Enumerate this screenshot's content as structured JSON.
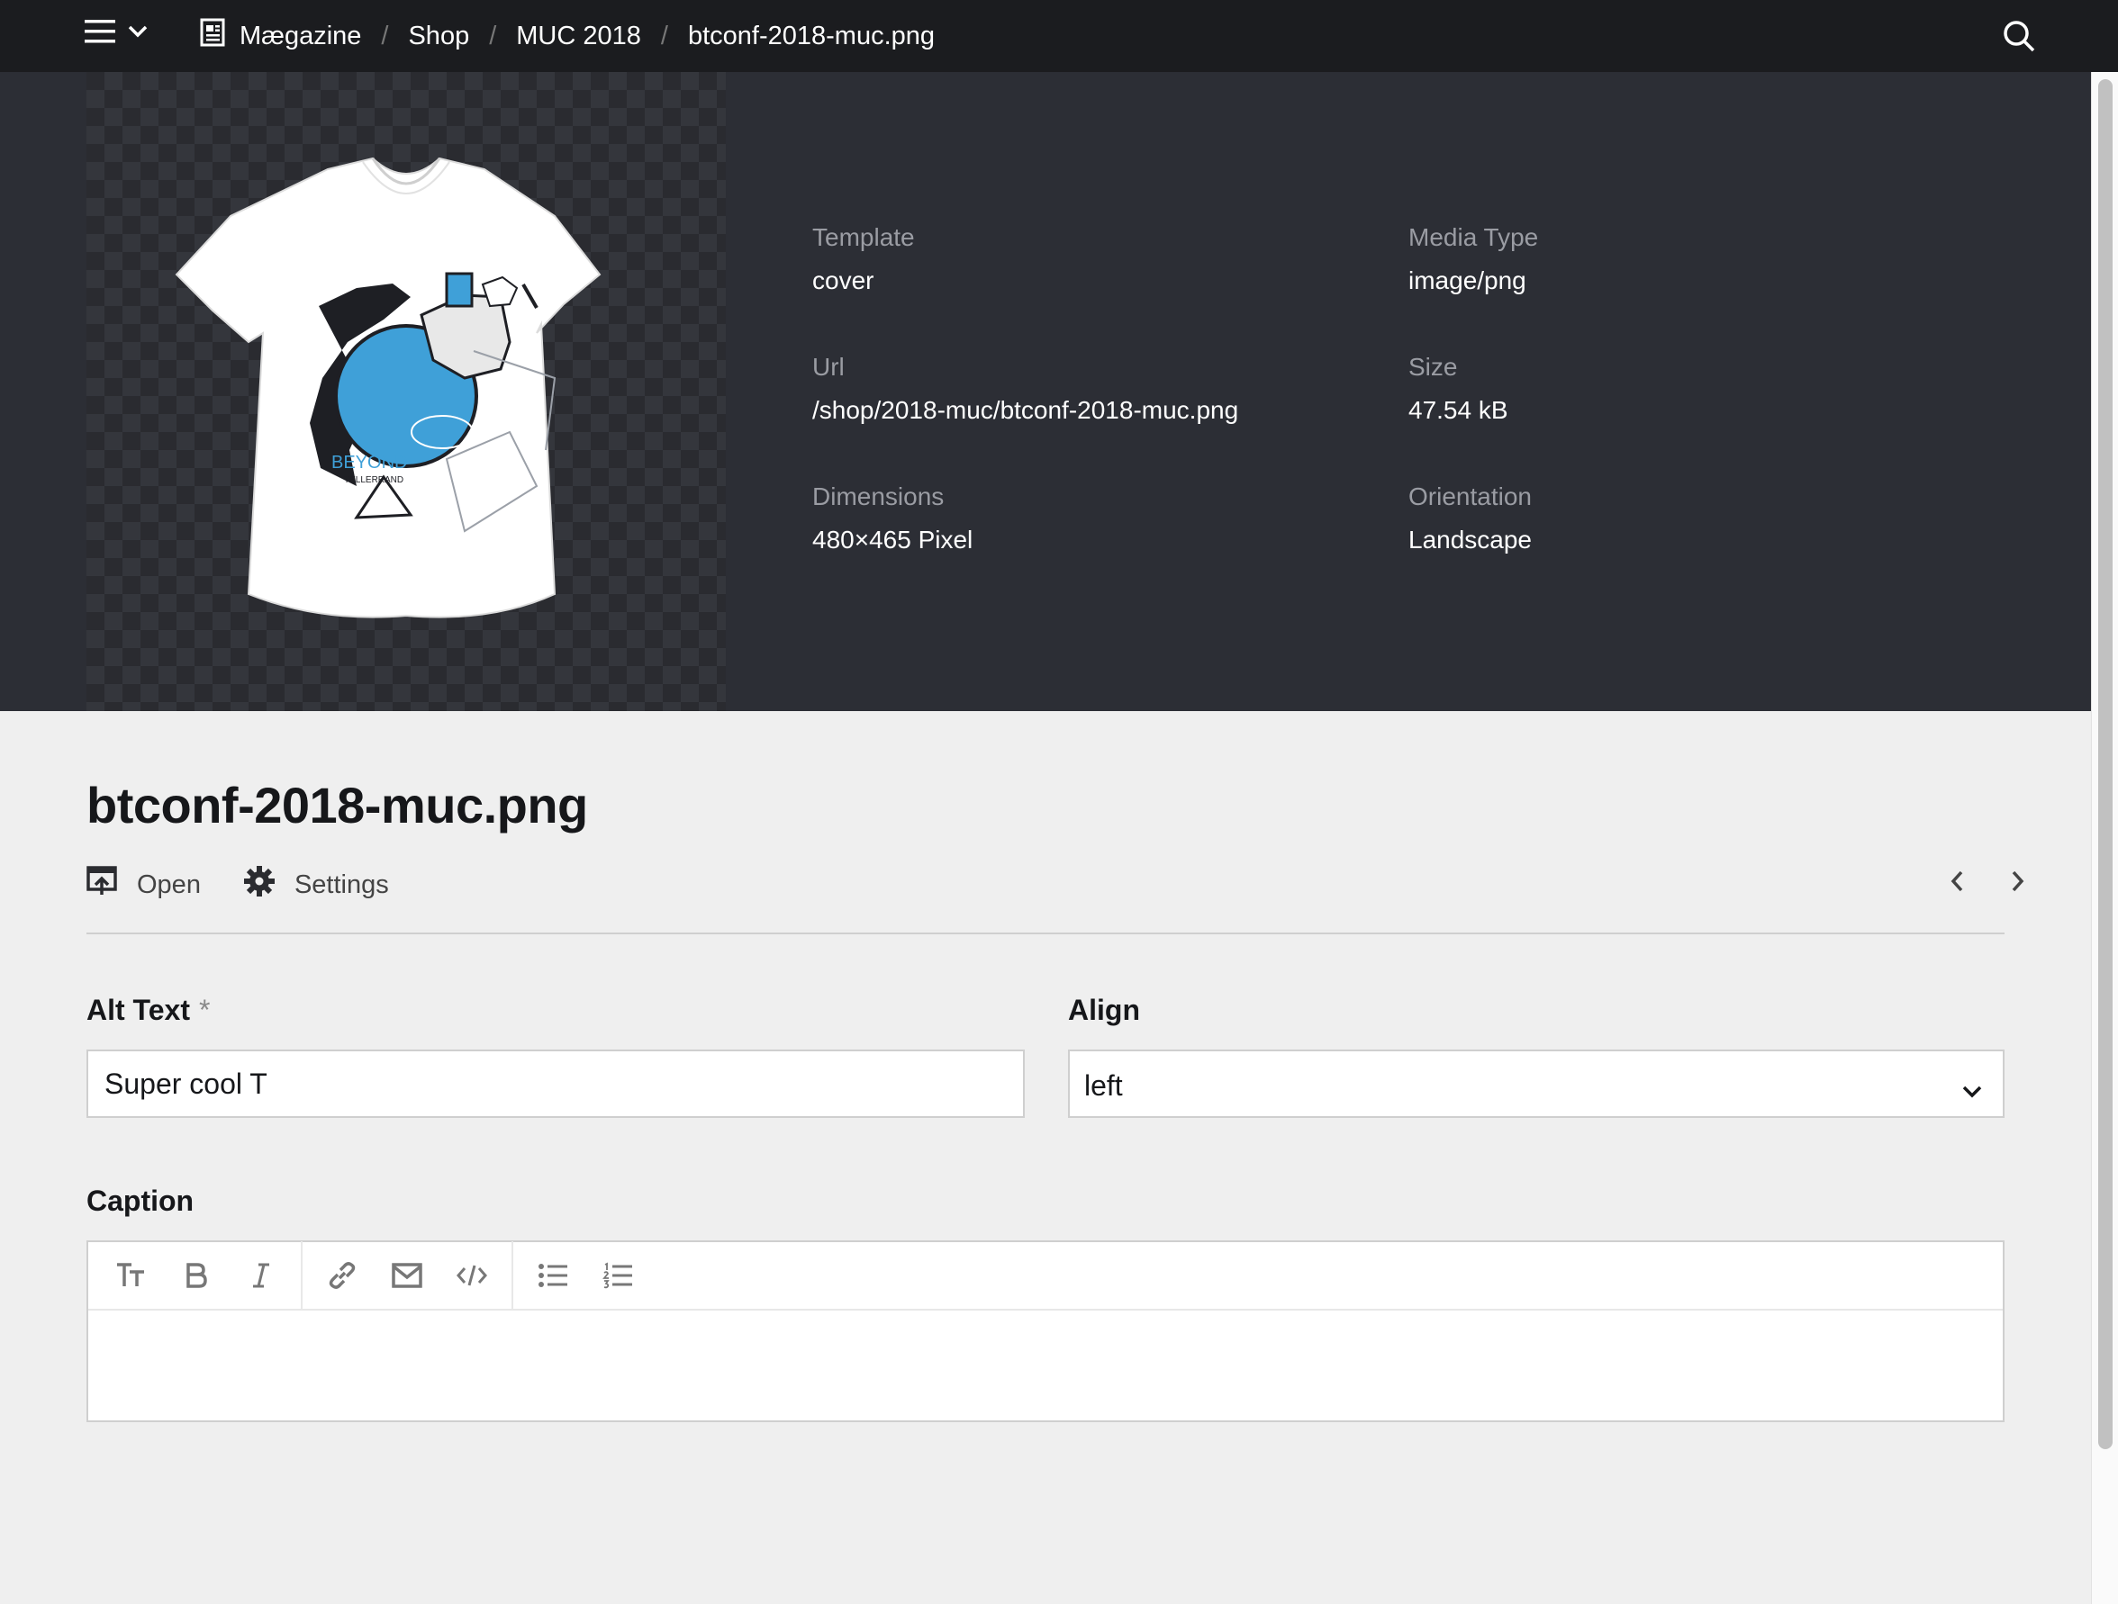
{
  "topbar": {
    "breadcrumb": [
      "Mægazine",
      "Shop",
      "MUC 2018",
      "btconf-2018-muc.png"
    ],
    "icons": [
      "menu-icon",
      "chevron-down-icon",
      "document-icon",
      "search-icon"
    ]
  },
  "preview": {
    "image_alt": "btconf-2018-muc.png",
    "print_text": [
      "BEYOND",
      "TELLERRAND"
    ]
  },
  "meta": {
    "template_label": "Template",
    "template_value": "cover",
    "mediatype_label": "Media Type",
    "mediatype_value": "image/png",
    "url_label": "Url",
    "url_value": "/shop/2018-muc/btconf-2018-muc.png",
    "size_label": "Size",
    "size_value": "47.54 kB",
    "dimensions_label": "Dimensions",
    "dimensions_value": "480×465 Pixel",
    "orientation_label": "Orientation",
    "orientation_value": "Landscape"
  },
  "page": {
    "title": "btconf-2018-muc.png",
    "open_label": "Open",
    "settings_label": "Settings"
  },
  "form": {
    "alt_label": "Alt Text",
    "alt_required": "*",
    "alt_value": "Super cool T",
    "align_label": "Align",
    "align_value": "left",
    "caption_label": "Caption",
    "toolbar_icons": [
      "headings-icon",
      "bold-icon",
      "italic-icon",
      "link-icon",
      "email-icon",
      "code-icon",
      "bullet-list-icon",
      "ordered-list-icon"
    ]
  },
  "colors": {
    "topbar": "#1b1c1f",
    "header_bg": "#2c2e35",
    "page_bg": "#efefef",
    "shirt_accent": "#3fa0d8"
  }
}
